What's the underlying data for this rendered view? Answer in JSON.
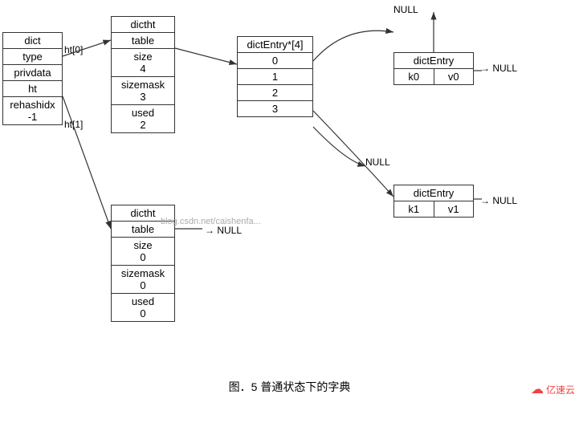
{
  "diagram": {
    "title": "图．5    普通状态下的字典",
    "watermark": "blog.csdn.net/caishenfa...",
    "logo": "亿速云",
    "dict_box": {
      "label": "dict",
      "cells": [
        "dict",
        "type",
        "privdata",
        "ht",
        "rehashidx\n-1"
      ]
    },
    "ht0_label": "ht[0]",
    "ht1_label": "ht[1]",
    "dictht_top": {
      "cells": [
        "dictht",
        "table",
        "size\n4",
        "sizemask\n3",
        "used\n2"
      ]
    },
    "dictht_bottom": {
      "cells": [
        "dictht",
        "table",
        "size\n0",
        "sizemask\n0",
        "used\n0"
      ]
    },
    "dictentry_array": {
      "label": "dictEntry*[4]",
      "cells": [
        "0",
        "1",
        "2",
        "3"
      ]
    },
    "dictentry_top": {
      "cells": [
        "dictEntry",
        "k0",
        "v0"
      ]
    },
    "dictentry_bottom": {
      "cells": [
        "dictEntry",
        "k1",
        "v1"
      ]
    },
    "null_labels": [
      "NULL",
      "NULL",
      "NULL",
      "NULL",
      "NULL"
    ]
  }
}
